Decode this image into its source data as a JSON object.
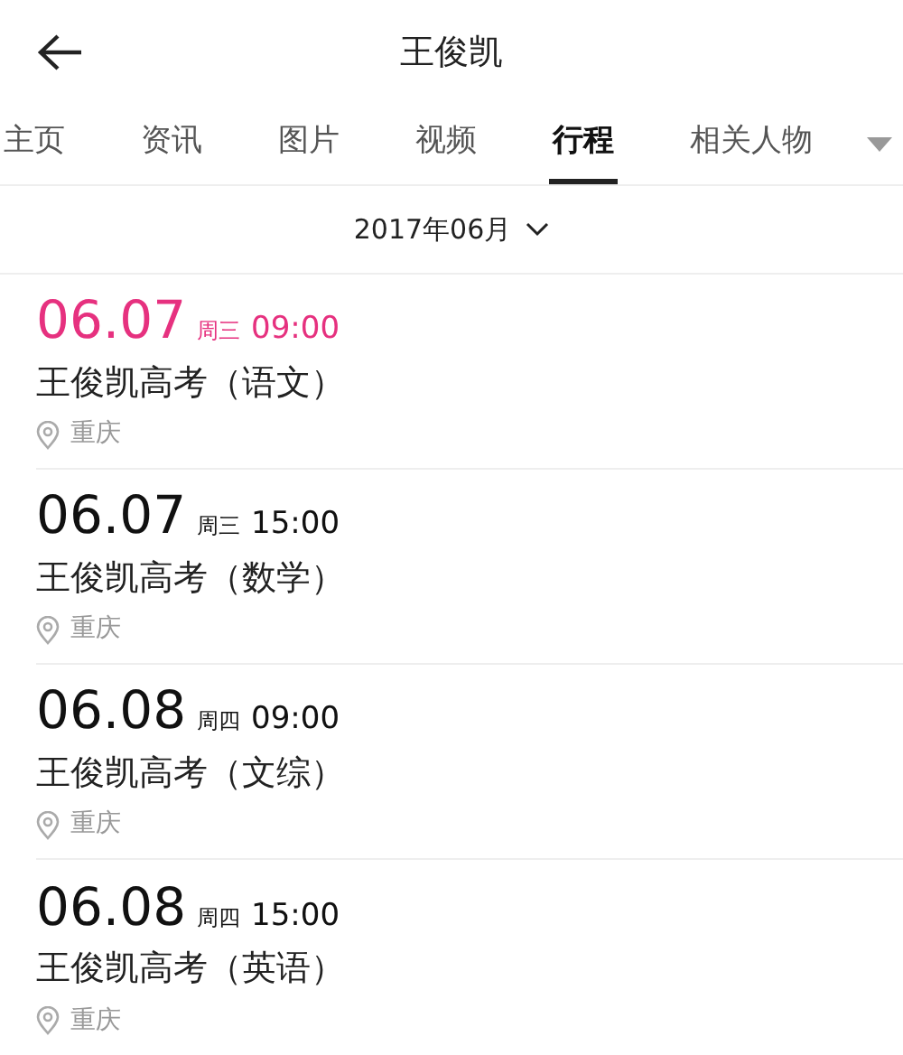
{
  "header": {
    "title": "王俊凯"
  },
  "tabs": [
    {
      "label": "主页",
      "selected": false
    },
    {
      "label": "资讯",
      "selected": false
    },
    {
      "label": "图片",
      "selected": false
    },
    {
      "label": "视频",
      "selected": false
    },
    {
      "label": "行程",
      "selected": true
    },
    {
      "label": "相关人物",
      "selected": false
    }
  ],
  "month_picker": {
    "label": "2017年06月"
  },
  "events": [
    {
      "date": "06.07",
      "weekday": "周三",
      "time": "09:00",
      "title": "王俊凯高考（语文）",
      "location": "重庆",
      "highlighted": true
    },
    {
      "date": "06.07",
      "weekday": "周三",
      "time": "15:00",
      "title": "王俊凯高考（数学）",
      "location": "重庆",
      "highlighted": false
    },
    {
      "date": "06.08",
      "weekday": "周四",
      "time": "09:00",
      "title": "王俊凯高考（文综）",
      "location": "重庆",
      "highlighted": false
    },
    {
      "date": "06.08",
      "weekday": "周四",
      "time": "15:00",
      "title": "王俊凯高考（英语）",
      "location": "重庆",
      "highlighted": false
    }
  ]
}
